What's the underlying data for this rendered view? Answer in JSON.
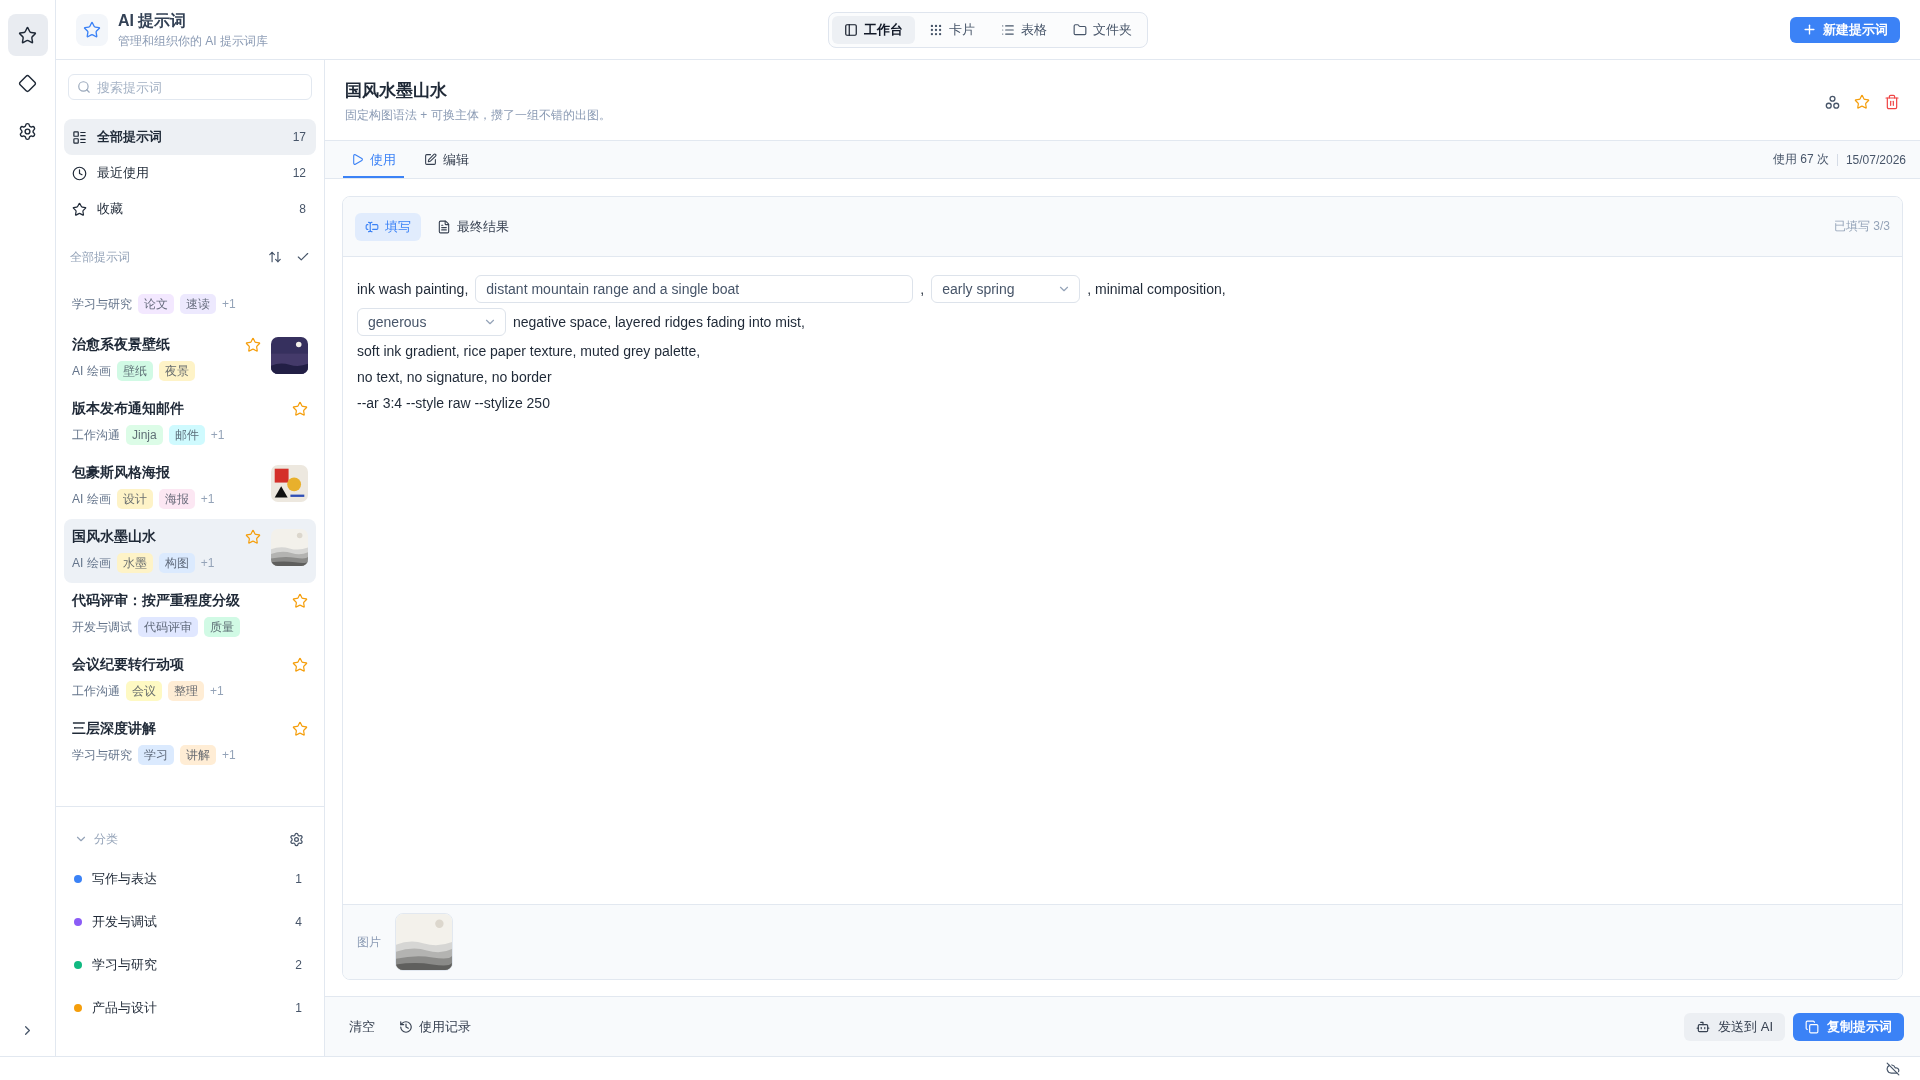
{
  "rail": {
    "buttons": [
      {
        "selected": true
      },
      {
        "selected": false
      },
      {
        "selected": false
      }
    ]
  },
  "header": {
    "title": "AI 提示词",
    "subtitle": "管理和组织你的 AI 提示词库",
    "views": [
      {
        "label": "工作台",
        "selected": true
      },
      {
        "label": "卡片",
        "selected": false
      },
      {
        "label": "表格",
        "selected": false
      },
      {
        "label": "文件夹",
        "selected": false
      }
    ],
    "new_button": "新建提示词"
  },
  "sidebar": {
    "search": {
      "placeholder": "搜索提示词"
    },
    "nav": [
      {
        "label": "全部提示词",
        "count": "17",
        "selected": true
      },
      {
        "label": "最近使用",
        "count": "12",
        "selected": false
      },
      {
        "label": "收藏",
        "count": "8",
        "selected": false
      }
    ],
    "list_title": "全部提示词",
    "prompts": [
      {
        "category": "学习与研究",
        "tags": [
          {
            "label": "论文",
            "color": "#f3e8ff"
          },
          {
            "label": "速读",
            "color": "#ede9fe"
          }
        ],
        "more": "+1",
        "selected": false
      },
      {
        "title": "治愈系夜景壁纸",
        "category": "AI 绘画",
        "tags": [
          {
            "label": "壁纸",
            "color": "#d1fae5"
          },
          {
            "label": "夜景",
            "color": "#fef3c7"
          }
        ],
        "favorite": true,
        "thumbnail": {
          "kind": "night"
        },
        "selected": false
      },
      {
        "title": "版本发布通知邮件",
        "category": "工作沟通",
        "tags": [
          {
            "label": "Jinja",
            "color": "#dcfce7"
          },
          {
            "label": "邮件",
            "color": "#cffafe"
          }
        ],
        "more": "+1",
        "favorite": true,
        "selected": false
      },
      {
        "title": "包豪斯风格海报",
        "category": "AI 绘画",
        "tags": [
          {
            "label": "设计",
            "color": "#fef3c7"
          },
          {
            "label": "海报",
            "color": "#fce7f3"
          }
        ],
        "more": "+1",
        "favorite": false,
        "thumbnail": {
          "kind": "bauhaus"
        },
        "selected": false
      },
      {
        "title": "国风水墨山水",
        "category": "AI 绘画",
        "tags": [
          {
            "label": "水墨",
            "color": "#fef3c7"
          },
          {
            "label": "构图",
            "color": "#dbeafe"
          }
        ],
        "more": "+1",
        "favorite": true,
        "thumbnail": {
          "kind": "ink"
        },
        "selected": true
      },
      {
        "title": "代码评审：按严重程度分级",
        "category": "开发与调试",
        "tags": [
          {
            "label": "代码评审",
            "color": "#e0e7ff"
          },
          {
            "label": "质量",
            "color": "#d1fae5"
          }
        ],
        "favorite": true,
        "selected": false
      },
      {
        "title": "会议纪要转行动项",
        "category": "工作沟通",
        "tags": [
          {
            "label": "会议",
            "color": "#fef9c3"
          },
          {
            "label": "整理",
            "color": "#ffedd5"
          }
        ],
        "more": "+1",
        "favorite": true,
        "selected": false
      },
      {
        "title": "三层深度讲解",
        "category": "学习与研究",
        "tags": [
          {
            "label": "学习",
            "color": "#dbeafe"
          },
          {
            "label": "讲解",
            "color": "#ffedd5"
          }
        ],
        "more": "+1",
        "favorite": true,
        "selected": false
      }
    ],
    "categories": {
      "title": "分类",
      "expanded": true,
      "items": [
        {
          "label": "写作与表达",
          "count": "1",
          "color": "#3b82f6"
        },
        {
          "label": "开发与调试",
          "count": "4",
          "color": "#8b5cf6"
        },
        {
          "label": "学习与研究",
          "count": "2",
          "color": "#10b981"
        },
        {
          "label": "产品与设计",
          "count": "1",
          "color": "#f59e0b"
        }
      ]
    }
  },
  "detail": {
    "title": "国风水墨山水",
    "subtitle": "固定构图语法 + 可换主体，攒了一组不错的出图。",
    "favorite": true,
    "tabs": [
      {
        "label": "使用",
        "selected": true
      },
      {
        "label": "编辑",
        "selected": false
      }
    ],
    "usage": "使用 67 次",
    "date": "15/07/2026",
    "mode_tabs": [
      {
        "label": "填写",
        "selected": true
      },
      {
        "label": "最终结果",
        "selected": false
      }
    ],
    "filled_count": "已填写 3/3",
    "template": [
      [
        {
          "kind": "text",
          "text": "ink wash painting,"
        },
        {
          "kind": "input",
          "value": "distant mountain range and a single boat"
        },
        {
          "kind": "text",
          "text": ","
        },
        {
          "kind": "select",
          "value": "early spring"
        },
        {
          "kind": "text",
          "text": ", minimal composition,"
        }
      ],
      [
        {
          "kind": "select",
          "value": "generous"
        },
        {
          "kind": "text",
          "text": "negative space, layered ridges fading into mist,"
        }
      ],
      [
        {
          "kind": "text",
          "text": "soft ink gradient, rice paper texture, muted grey palette,"
        }
      ],
      [
        {
          "kind": "text",
          "text": "no text, no signature, no border"
        }
      ],
      [
        {
          "kind": "text",
          "text": "--ar 3:4 --style raw --stylize 250"
        }
      ]
    ],
    "image": {
      "label": "图片",
      "thumbnail": {
        "kind": "ink"
      }
    },
    "actions": {
      "clear": "清空",
      "history": "使用记录",
      "send": "发送到 AI",
      "copy": "复制提示词"
    }
  }
}
